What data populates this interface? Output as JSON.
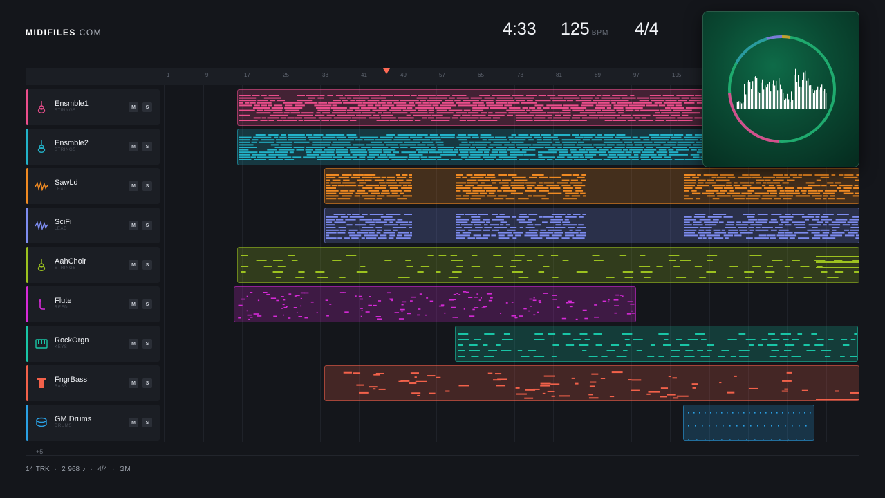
{
  "brand": {
    "name": "MIDIFILES",
    "domain": ".COM"
  },
  "stats": {
    "duration": "4:33",
    "tempo": "125",
    "tempo_unit": "BPM",
    "signature": "4/4"
  },
  "ruler_ticks": [
    "1",
    "9",
    "17",
    "25",
    "33",
    "41",
    "49",
    "57",
    "65",
    "73",
    "81",
    "89",
    "97",
    "105"
  ],
  "tracks": [
    {
      "name": "Ensmble1",
      "category": "STRINGS",
      "color": "#ec4e8c",
      "icon": "violin-icon",
      "mute": "M",
      "solo": "S"
    },
    {
      "name": "Ensmble2",
      "category": "STRINGS",
      "color": "#22b3c9",
      "icon": "violin-icon",
      "mute": "M",
      "solo": "S"
    },
    {
      "name": "SawLd",
      "category": "LEAD",
      "color": "#f08a22",
      "icon": "wave-icon",
      "mute": "M",
      "solo": "S"
    },
    {
      "name": "SciFi",
      "category": "LEAD",
      "color": "#7d8cf0",
      "icon": "wave-icon",
      "mute": "M",
      "solo": "S"
    },
    {
      "name": "AahChoir",
      "category": "STRINGS",
      "color": "#9cc21f",
      "icon": "violin-icon",
      "mute": "M",
      "solo": "S"
    },
    {
      "name": "Flute",
      "category": "REED",
      "color": "#d62ad8",
      "icon": "flute-icon",
      "mute": "M",
      "solo": "S"
    },
    {
      "name": "RockOrgn",
      "category": "KEYS",
      "color": "#19c5a6",
      "icon": "keyboard-icon",
      "mute": "M",
      "solo": "S"
    },
    {
      "name": "FngrBass",
      "category": "BASS",
      "color": "#f2614a",
      "icon": "bass-amp-icon",
      "mute": "M",
      "solo": "S"
    },
    {
      "name": "GM Drums",
      "category": "DRUMS",
      "color": "#2aa0e4",
      "icon": "drum-icon",
      "mute": "M",
      "solo": "S"
    }
  ],
  "more_tracks": "+5",
  "footer": {
    "tracks": "14 TRK",
    "notes": "2 968 ♪",
    "signature": "4/4",
    "standard": "GM"
  }
}
